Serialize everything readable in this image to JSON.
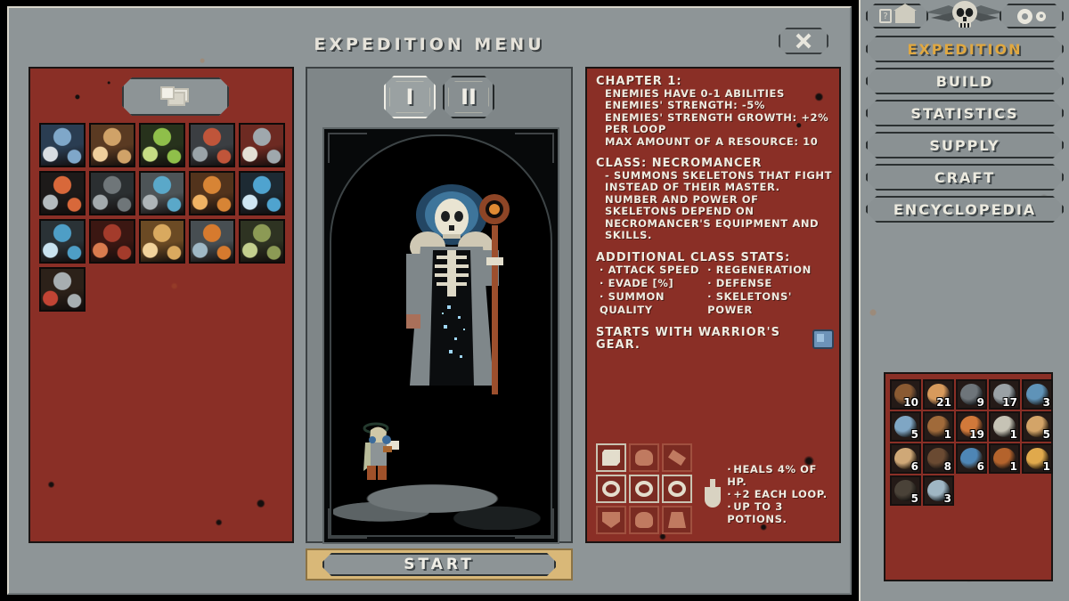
{
  "window": {
    "title": "EXPEDITION MENU",
    "close_icon": "crossed-bones-icon"
  },
  "left_panel": {
    "deck_tab_icon": "card-stack-icon",
    "cards": [
      {
        "name": "lich",
        "c1": "#7fa7c9",
        "c2": "#2a3d52",
        "c3": "#d8dde2"
      },
      {
        "name": "sand-dunes",
        "c1": "#d0a268",
        "c2": "#5a3a22",
        "c3": "#f0cf9c"
      },
      {
        "name": "grove",
        "c1": "#8fbf4a",
        "c2": "#27321c",
        "c3": "#c6dd84"
      },
      {
        "name": "temple",
        "c1": "#c0553a",
        "c2": "#3b3e42",
        "c3": "#9aa3a8"
      },
      {
        "name": "bone-shrine",
        "c1": "#9fa8ad",
        "c2": "#6d2a22",
        "c3": "#e3e0d5"
      },
      {
        "name": "smoke-tower",
        "c1": "#d8683a",
        "c2": "#1d1a19",
        "c3": "#b4bbbe"
      },
      {
        "name": "rocks",
        "c1": "#6f7679",
        "c2": "#2b2f31",
        "c3": "#a3aaad"
      },
      {
        "name": "mountain",
        "c1": "#5aa8c9",
        "c2": "#4d5457",
        "c3": "#aeb5b8"
      },
      {
        "name": "autumn-tree",
        "c1": "#d78435",
        "c2": "#52331c",
        "c3": "#f0b364"
      },
      {
        "name": "frozen-monolith",
        "c1": "#4fa3cf",
        "c2": "#1d2a33",
        "c3": "#cfe6f2"
      },
      {
        "name": "ice-cave",
        "c1": "#4e9ec6",
        "c2": "#2a3236",
        "c3": "#c9e3f0"
      },
      {
        "name": "blood-fields",
        "c1": "#a33b2b",
        "c2": "#3b1712",
        "c3": "#d97b4e"
      },
      {
        "name": "wheat-field",
        "c1": "#d9a95f",
        "c2": "#6b4a24",
        "c3": "#f2d29b"
      },
      {
        "name": "battle-camp",
        "c1": "#d67a2e",
        "c2": "#474e52",
        "c3": "#9fb8c6"
      },
      {
        "name": "thicket",
        "c1": "#8c9a55",
        "c2": "#2e3322",
        "c3": "#c3cf8e"
      },
      {
        "name": "mausoleum",
        "c1": "#a7aeb1",
        "c2": "#2c2119",
        "c3": "#c24434"
      }
    ]
  },
  "center_panel": {
    "chapters": [
      {
        "label": "I",
        "active": true
      },
      {
        "label": "II",
        "active": false
      }
    ],
    "hero_art": "necromancer-portrait",
    "walker_art": "hero-walking-sprite",
    "class_buttons": [
      {
        "name": "warrior-class-button",
        "icon": "sword-icon"
      },
      {
        "name": "necromancer-class-button",
        "icon": "skull-icon"
      }
    ],
    "start_label": "START"
  },
  "info_panel": {
    "chapter_heading": "CHAPTER 1:",
    "chapter_lines": [
      "ENEMIES HAVE 0-1 ABILITIES",
      "ENEMIES' STRENGTH: -5%",
      "ENEMIES' STRENGTH GROWTH: +2% PER LOOP",
      "MAX AMOUNT OF A RESOURCE: 10"
    ],
    "class_heading": "CLASS: NECROMANCER",
    "class_description": "- SUMMONS SKELETONS THAT FIGHT INSTEAD OF THEIR MASTER. NUMBER AND POWER OF SKELETONS DEPEND ON NECROMANCER'S EQUIPMENT AND SKILLS.",
    "stats_heading": "ADDITIONAL CLASS STATS:",
    "stats_col_a": [
      "ATTACK SPEED",
      "EVADE [%]",
      "SUMMON QUALITY"
    ],
    "stats_col_b": [
      "REGENERATION",
      "DEFENSE",
      "SKELETONS' POWER"
    ],
    "gear_line": "STARTS WITH WARRIOR'S GEAR.",
    "gear_icon": "glove-icon",
    "equipment_slots": [
      {
        "name": "helmet-slot",
        "icon": "scroll-icon",
        "highlight": true
      },
      {
        "name": "amulet-slot",
        "icon": "mask-icon",
        "highlight": false
      },
      {
        "name": "cloak-slot",
        "icon": "bracer-icon",
        "highlight": false
      },
      {
        "name": "ring-left-slot",
        "icon": "ring-icon",
        "highlight": true
      },
      {
        "name": "weapon-slot",
        "icon": "shield-round-icon",
        "highlight": true
      },
      {
        "name": "ring-right-slot",
        "icon": "ring-icon",
        "highlight": true
      },
      {
        "name": "shield-slot",
        "icon": "shield-icon",
        "highlight": false
      },
      {
        "name": "armor-slot",
        "icon": "armor-icon",
        "highlight": false
      },
      {
        "name": "boots-slot",
        "icon": "boots-icon",
        "highlight": false
      }
    ],
    "potion_icon": "potion-icon",
    "potion_notes": [
      "HEALS 4% OF HP.",
      "+2 EACH LOOP.",
      "UP TO 3 POTIONS."
    ]
  },
  "sidebar": {
    "top_buttons": [
      {
        "name": "help-home-button",
        "icons": [
          "question-icon",
          "house-icon"
        ]
      },
      {
        "name": "settings-button",
        "icons": [
          "gear-icon",
          "gear-small-icon"
        ]
      }
    ],
    "emblem": "winged-skull-emblem",
    "nav_items": [
      {
        "label": "EXPEDITION",
        "active": true
      },
      {
        "label": "BUILD",
        "active": false
      },
      {
        "label": "STATISTICS",
        "active": false
      },
      {
        "label": "SUPPLY",
        "active": false
      },
      {
        "label": "CRAFT",
        "active": false
      },
      {
        "label": "ENCYCLOPEDIA",
        "active": false
      }
    ],
    "resources": [
      {
        "name": "wood-resource",
        "count": "10",
        "c1": "#8a5a32",
        "c2": "#2e2420"
      },
      {
        "name": "food-rations-resource",
        "count": "21",
        "c1": "#d79a5c",
        "c2": "#3a2a20"
      },
      {
        "name": "stone-resource",
        "count": "9",
        "c1": "#6e757a",
        "c2": "#1e2224"
      },
      {
        "name": "boulder-resource",
        "count": "17",
        "c1": "#9aa1a5",
        "c2": "#2a2e30"
      },
      {
        "name": "metal-ore-resource",
        "count": "3",
        "c1": "#5f93b8",
        "c2": "#232b31"
      },
      {
        "name": "stable-metal-resource",
        "count": "5",
        "c1": "#7fa6c4",
        "c2": "#242c31"
      },
      {
        "name": "branches-resource",
        "count": "1",
        "c1": "#a06a3a",
        "c2": "#2c2118"
      },
      {
        "name": "orb-of-immortality",
        "count": "19",
        "c1": "#d2793a",
        "c2": "#3a2317"
      },
      {
        "name": "bone-resource",
        "count": "1",
        "c1": "#c6c3b5",
        "c2": "#2c2a26"
      },
      {
        "name": "book-resource",
        "count": "5",
        "c1": "#d3a468",
        "c2": "#3b2b19"
      },
      {
        "name": "scroll-resource",
        "count": "6",
        "c1": "#cfa877",
        "c2": "#35281a"
      },
      {
        "name": "iron-ring-resource",
        "count": "8",
        "c1": "#6a4a32",
        "c2": "#201a16"
      },
      {
        "name": "orb-resource",
        "count": "6",
        "c1": "#4e86b5",
        "c2": "#2a2018"
      },
      {
        "name": "insect-resource",
        "count": "1",
        "c1": "#b4632c",
        "c2": "#251a14"
      },
      {
        "name": "gold-orb-resource",
        "count": "1",
        "c1": "#e0a94c",
        "c2": "#3a2a13"
      },
      {
        "name": "coal-resource",
        "count": "5",
        "c1": "#4a4238",
        "c2": "#1a1714"
      },
      {
        "name": "marble-orb-resource",
        "count": "3",
        "c1": "#9fb6c4",
        "c2": "#273036"
      }
    ]
  },
  "colors": {
    "panel_gray": "#8e9597",
    "panel_red": "#8a2f26",
    "accent_gold": "#e0a841",
    "start_bar": "#d9b878",
    "text_light": "#f0ece1"
  }
}
